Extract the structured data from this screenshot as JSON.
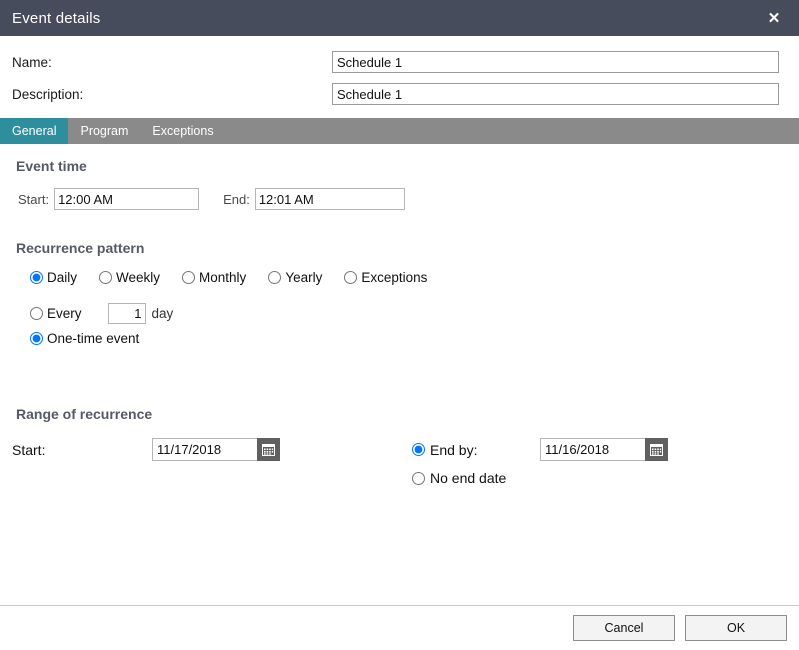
{
  "window": {
    "title": "Event details",
    "close_label": "✕"
  },
  "header_form": {
    "name_label": "Name:",
    "name_value": "Schedule 1",
    "name_placeholder": "",
    "description_label": "Description:",
    "description_value": "Schedule 1",
    "description_placeholder": ""
  },
  "tabs": [
    {
      "label": "General",
      "active": true
    },
    {
      "label": "Program",
      "active": false
    },
    {
      "label": "Exceptions",
      "active": false
    }
  ],
  "event_time": {
    "section_title": "Event time",
    "start_label": "Start:",
    "start_value": "12:00 AM",
    "end_label": "End:",
    "end_value": "12:01 AM"
  },
  "recurrence_pattern": {
    "section_title": "Recurrence pattern",
    "options": [
      {
        "label": "Daily",
        "selected": true
      },
      {
        "label": "Weekly",
        "selected": false
      },
      {
        "label": "Monthly",
        "selected": false
      },
      {
        "label": "Yearly",
        "selected": false
      },
      {
        "label": "Exceptions",
        "selected": false
      }
    ],
    "every_label": "Every",
    "every_value": "1",
    "every_unit": "day",
    "every_selected": false,
    "onetime_label": "One-time event",
    "onetime_selected": true
  },
  "range_of_recurrence": {
    "section_title": "Range of recurrence",
    "start_label": "Start:",
    "start_date": "11/17/2018",
    "start_calendar_icon": "calendar-icon",
    "end_by_label": "End by:",
    "end_by_selected": true,
    "end_date": "11/16/2018",
    "end_calendar_icon": "calendar-icon",
    "no_end_date_label": "No end date",
    "no_end_date_selected": false
  },
  "footer": {
    "cancel_label": "Cancel",
    "ok_label": "OK"
  },
  "colors": {
    "titlebar_bg": "#474c5c",
    "tabstrip_bg": "#8a8a8a",
    "active_tab_bg": "#2d8f9e",
    "section_title": "#555a66",
    "calendar_button_bg": "#606060"
  }
}
